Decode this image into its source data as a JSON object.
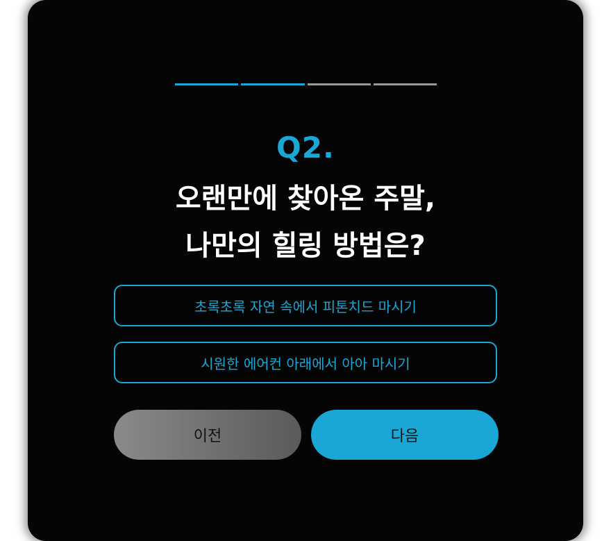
{
  "progress": {
    "current_step": 2,
    "total_steps": 4,
    "active_color": "#1aa7d6",
    "inactive_color": "#9a9a9a"
  },
  "question": {
    "number": "Q2.",
    "title_line1": "오랜만에 찾아온 주말,",
    "title_line2": "나만의 힐링 방법은?"
  },
  "options": [
    {
      "label": "초록초록 자연 속에서 피톤치드 마시기"
    },
    {
      "label": "시원한 에어컨 아래에서 아아 마시기"
    }
  ],
  "buttons": {
    "prev_label": "이전",
    "next_label": "다음"
  },
  "colors": {
    "accent": "#1aa7d6",
    "background": "#050505"
  }
}
